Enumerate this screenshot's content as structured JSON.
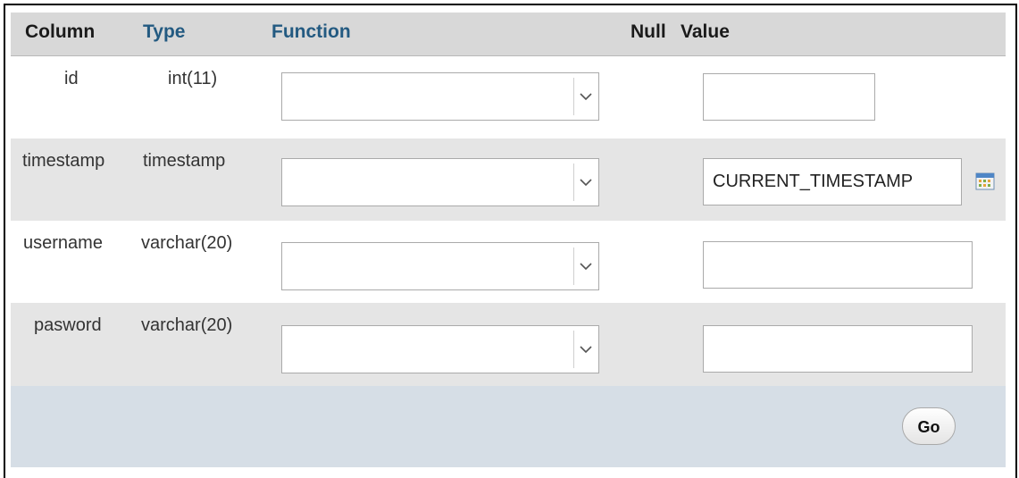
{
  "header": {
    "column": "Column",
    "type": "Type",
    "function": "Function",
    "null": "Null",
    "value": "Value"
  },
  "rows": [
    {
      "column": "id",
      "type": "int(11)",
      "function": "",
      "value": ""
    },
    {
      "column": "timestamp",
      "type": "timestamp",
      "function": "",
      "value": "CURRENT_TIMESTAMP"
    },
    {
      "column": "username",
      "type": "varchar(20)",
      "function": "",
      "value": ""
    },
    {
      "column": "pasword",
      "type": "varchar(20)",
      "function": "",
      "value": ""
    }
  ],
  "footer": {
    "go_label": "Go"
  },
  "icons": {
    "select_arrow": "chevron-down-icon",
    "calendar": "calendar-icon"
  },
  "colors": {
    "header_bg": "#d8d8d8",
    "header_link": "#235a81",
    "row_alt_bg": "#e5e5e5",
    "footer_bg": "#d6dee6"
  }
}
